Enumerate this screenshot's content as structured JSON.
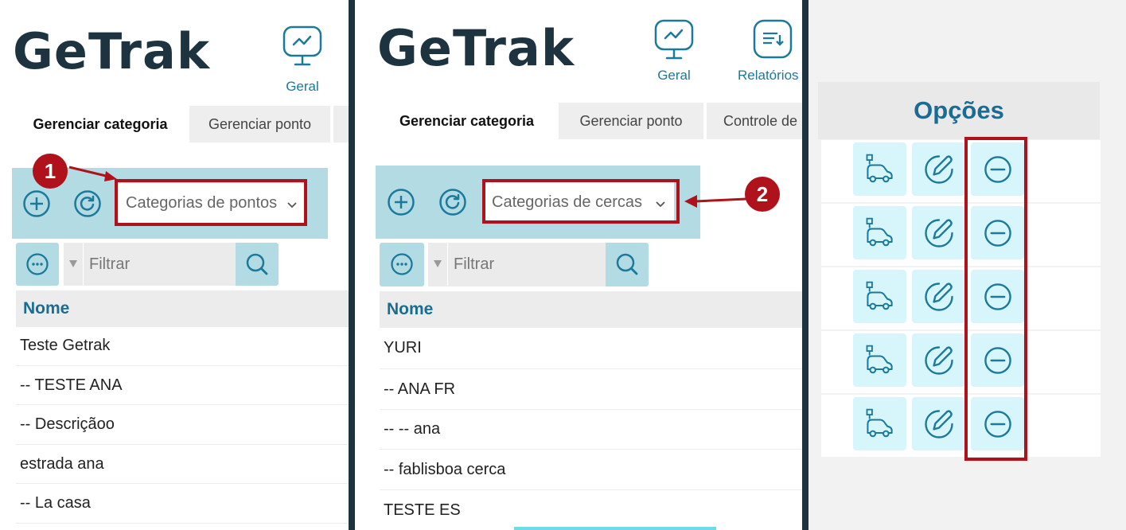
{
  "brand": {
    "logo_text": "GeTrak"
  },
  "panel1": {
    "nav": [
      {
        "label": "Geral",
        "icon": "monitor-chart-icon"
      }
    ],
    "tabs": [
      {
        "label": "Gerenciar categoria",
        "active": true
      },
      {
        "label": "Gerenciar ponto",
        "active": false
      },
      {
        "label": "",
        "active": false
      }
    ],
    "select_value": "Categorias de pontos",
    "filter_placeholder": "Filtrar",
    "column_header": "Nome",
    "rows": [
      "Teste Getrak",
      "-- TESTE ANA",
      "-- Descriçãoo",
      "estrada ana",
      "-- La casa"
    ],
    "callout_number": "1"
  },
  "panel2": {
    "nav": [
      {
        "label": "Geral",
        "icon": "monitor-chart-icon"
      },
      {
        "label": "Relatórios",
        "icon": "report-icon"
      }
    ],
    "tabs": [
      {
        "label": "Gerenciar categoria",
        "active": true
      },
      {
        "label": "Gerenciar ponto",
        "active": false
      },
      {
        "label": "Controle de",
        "active": false
      }
    ],
    "select_value": "Categorias de cercas",
    "filter_placeholder": "Filtrar",
    "column_header": "Nome",
    "rows": [
      "YURI",
      "-- ANA FR",
      "-- -- ana",
      "-- fablisboa cerca",
      "TESTE ES"
    ],
    "callout_number": "2"
  },
  "panel3": {
    "header": "Opções",
    "row_count": 5,
    "actions": [
      {
        "name": "vehicle-route-icon"
      },
      {
        "name": "edit-icon"
      },
      {
        "name": "remove-icon"
      }
    ]
  },
  "colors": {
    "brand_dark": "#1d3440",
    "accent_teal": "#1b7a9c",
    "toolbar_bg": "#b3dbe3",
    "option_bg": "#d6f6fb",
    "highlight_red": "#b0121b"
  }
}
